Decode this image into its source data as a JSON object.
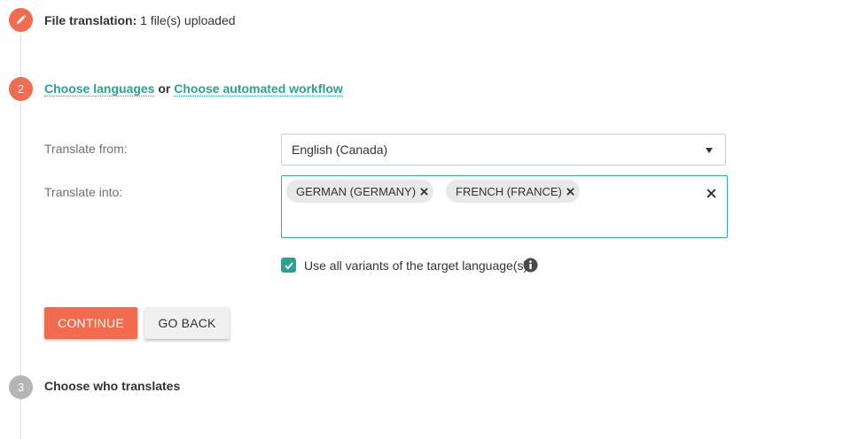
{
  "steps": {
    "step1": {
      "bold": "File translation:",
      "detail": "1 file(s) uploaded"
    },
    "step2": {
      "number": "2",
      "link1": "Choose languages",
      "or": "or",
      "link2": "Choose automated workflow"
    },
    "step3": {
      "number": "3",
      "title": "Choose who translates"
    }
  },
  "form": {
    "from_label": "Translate from:",
    "from_value": "English (Canada)",
    "into_label": "Translate into:",
    "into_tags": [
      {
        "label": "GERMAN (GERMANY)"
      },
      {
        "label": "FRENCH (FRANCE)"
      }
    ],
    "variants_label": "Use all variants of the target language(s)",
    "variants_checked": true
  },
  "buttons": {
    "continue": "CONTINUE",
    "back": "GO BACK"
  },
  "colors": {
    "accent": "#f26b4e",
    "link": "#2ba196",
    "inactive_step": "#b5b5b5"
  }
}
